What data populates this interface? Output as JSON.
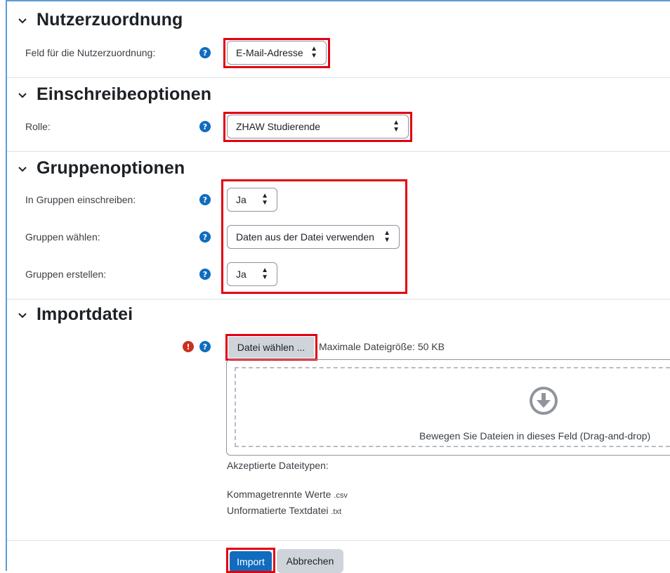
{
  "sections": {
    "user_mapping": {
      "title": "Nutzerzuordnung",
      "field_label": "Feld für die Nutzerzuordnung:",
      "field_value": "E-Mail-Adresse"
    },
    "enrol_options": {
      "title": "Einschreibeoptionen",
      "role_label": "Rolle:",
      "role_value": "ZHAW Studierende"
    },
    "group_options": {
      "title": "Gruppenoptionen",
      "enrol_groups_label": "In Gruppen einschreiben:",
      "enrol_groups_value": "Ja",
      "choose_groups_label": "Gruppen wählen:",
      "choose_groups_value": "Daten aus der Datei verwenden",
      "create_groups_label": "Gruppen erstellen:",
      "create_groups_value": "Ja"
    },
    "import_file": {
      "title": "Importdatei",
      "choose_file_label": "Datei wählen ...",
      "max_size": "Maximale Dateigröße: 50 KB",
      "drop_text": "Bewegen Sie Dateien in dieses Feld (Drag-and-drop)",
      "accepted_label": "Akzeptierte Dateitypen:",
      "types": [
        {
          "name": "Kommagetrennte Werte",
          "ext": ".csv"
        },
        {
          "name": "Unformatierte Textdatei",
          "ext": ".txt"
        }
      ]
    }
  },
  "actions": {
    "import_label": "Import",
    "cancel_label": "Abbrechen"
  },
  "colors": {
    "help": "#0f6cbf",
    "required": "#ca3120",
    "highlight": "#e3000f",
    "primary": "#0f6cbf"
  }
}
